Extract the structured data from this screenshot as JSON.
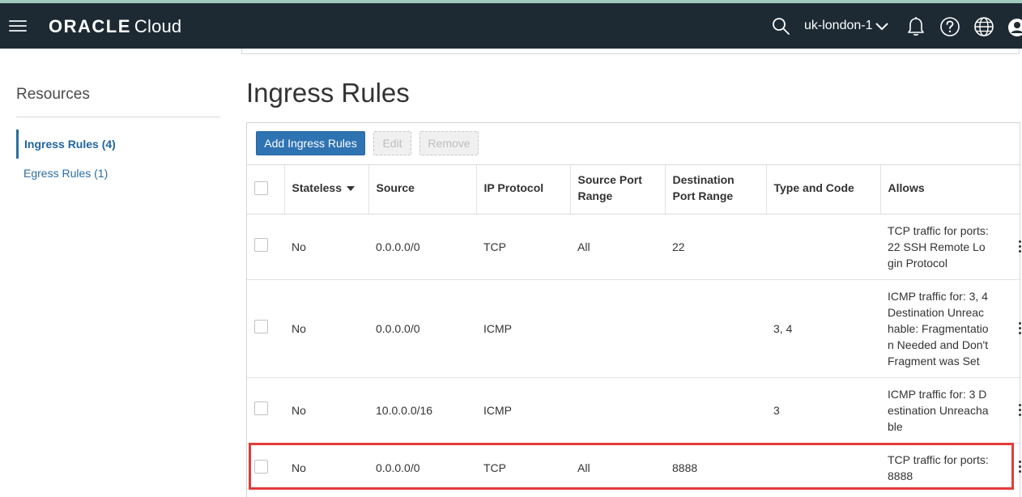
{
  "header": {
    "brand_oracle": "ORACLE",
    "brand_cloud": "Cloud",
    "region": "uk-london-1"
  },
  "sidebar": {
    "title": "Resources",
    "items": [
      {
        "label": "Ingress Rules (4)",
        "active": true
      },
      {
        "label": "Egress Rules (1)",
        "active": false
      }
    ]
  },
  "main": {
    "title": "Ingress Rules",
    "buttons": {
      "add": "Add Ingress Rules",
      "edit": "Edit",
      "remove": "Remove"
    },
    "columns": {
      "stateless": "Stateless",
      "source": "Source",
      "ip_protocol": "IP Protocol",
      "source_port_range": "Source Port Range",
      "destination_port_range": "Destination Port Range",
      "type_and_code": "Type and Code",
      "allows": "Allows"
    },
    "rows": [
      {
        "stateless": "No",
        "source": "0.0.0.0/0",
        "ip_protocol": "TCP",
        "source_port_range": "All",
        "destination_port_range": "22",
        "type_and_code": "",
        "allows": "TCP traffic for ports: 22 SSH Remote Login Protocol"
      },
      {
        "stateless": "No",
        "source": "0.0.0.0/0",
        "ip_protocol": "ICMP",
        "source_port_range": "",
        "destination_port_range": "",
        "type_and_code": "3, 4",
        "allows": "ICMP traffic for: 3, 4 Destination Unreachable: Fragmentation Needed and Don't Fragment was Set"
      },
      {
        "stateless": "No",
        "source": "10.0.0.0/16",
        "ip_protocol": "ICMP",
        "source_port_range": "",
        "destination_port_range": "",
        "type_and_code": "3",
        "allows": "ICMP traffic for: 3 Destination Unreachable"
      },
      {
        "stateless": "No",
        "source": "0.0.0.0/0",
        "ip_protocol": "TCP",
        "source_port_range": "All",
        "destination_port_range": "8888",
        "type_and_code": "",
        "allows": "TCP traffic for ports: 8888"
      }
    ]
  },
  "colors": {
    "header_bg": "#1d2a33",
    "link": "#2b6ea2",
    "primary_button": "#2f73b2",
    "highlight": "#e33b3b"
  },
  "icons": [
    "hamburger-icon",
    "search-icon",
    "chevron-down-icon",
    "bell-icon",
    "help-icon",
    "globe-icon",
    "user-icon",
    "sort-down-icon",
    "kebab-icon"
  ]
}
